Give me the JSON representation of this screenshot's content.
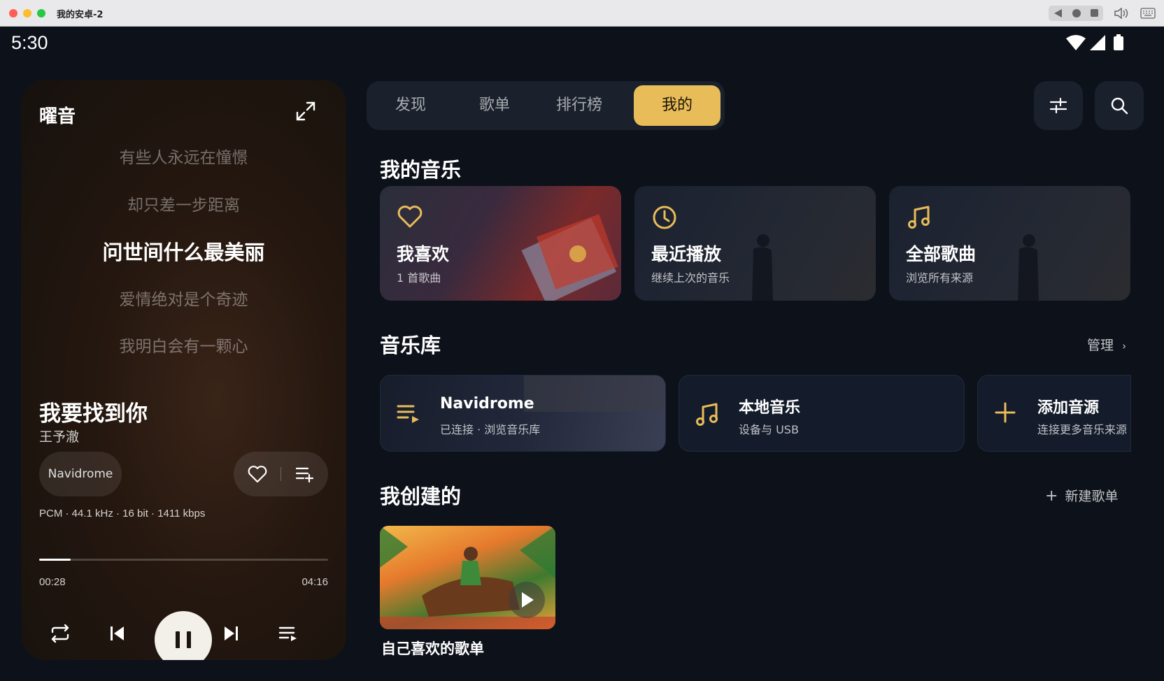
{
  "window": {
    "title": "我的安卓-2"
  },
  "status_bar": {
    "time": "5:30"
  },
  "player": {
    "brand": "曜音",
    "lyrics": [
      "有些人永远在憧憬",
      "却只差一步距离",
      "问世间什么最美丽",
      "爱情绝对是个奇迹",
      "我明白会有一颗心"
    ],
    "active_lyric_index": 2,
    "song_title": "我要找到你",
    "artist": "王予澈",
    "source": "Navidrome",
    "format": "PCM · 44.1 kHz · 16 bit · 1411 kbps",
    "current_time": "00:28",
    "total_time": "04:16",
    "progress": 0.11
  },
  "tabs": [
    {
      "label": "发现"
    },
    {
      "label": "歌单"
    },
    {
      "label": "排行榜"
    },
    {
      "label": "我的",
      "active": true
    }
  ],
  "my_music": {
    "title": "我的音乐",
    "cards": [
      {
        "title": "我喜欢",
        "subtitle": "1 首歌曲",
        "icon": "heart-icon"
      },
      {
        "title": "最近播放",
        "subtitle": "继续上次的音乐",
        "icon": "clock-icon"
      },
      {
        "title": "全部歌曲",
        "subtitle": "浏览所有来源",
        "icon": "music-note-icon"
      }
    ]
  },
  "library": {
    "title": "音乐库",
    "manage_label": "管理",
    "sources": [
      {
        "title": "Navidrome",
        "subtitle": "已连接 · 浏览音乐库",
        "icon": "playlist-play-icon"
      },
      {
        "title": "本地音乐",
        "subtitle": "设备与 USB",
        "icon": "music-note-icon"
      },
      {
        "title": "添加音源",
        "subtitle": "连接更多音乐来源",
        "icon": "plus-icon"
      }
    ]
  },
  "created": {
    "title": "我创建的",
    "new_label": "新建歌单",
    "playlists": [
      {
        "name": "自己喜欢的歌单"
      }
    ]
  },
  "colors": {
    "accent": "#e8bc58",
    "background": "#0c111a",
    "panel": "#1a202c"
  }
}
